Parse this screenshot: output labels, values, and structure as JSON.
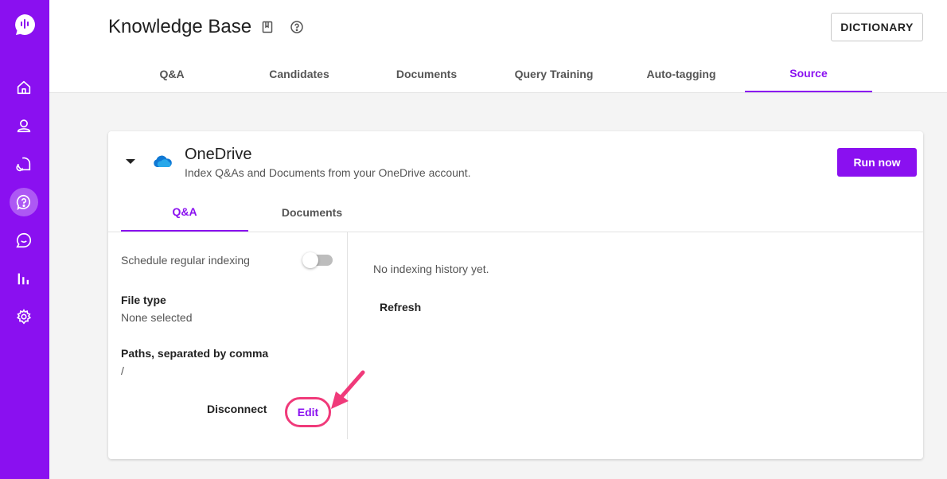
{
  "colors": {
    "brand": "#8a10f0",
    "highlight": "#f03a7a"
  },
  "sidebar": {
    "logo_icon": "chat-logo-icon",
    "items": [
      {
        "icon": "home-icon",
        "active": false
      },
      {
        "icon": "user-icon",
        "active": false
      },
      {
        "icon": "conversations-icon",
        "active": false
      },
      {
        "icon": "knowledge-base-icon",
        "active": true
      },
      {
        "icon": "chat-icon",
        "active": false
      },
      {
        "icon": "analytics-icon",
        "active": false
      },
      {
        "icon": "settings-icon",
        "active": false
      }
    ]
  },
  "header": {
    "title": "Knowledge Base",
    "book_icon": "book-icon",
    "help_icon": "help-icon",
    "dictionary_label": "DICTIONARY",
    "tabs": [
      "Q&A",
      "Candidates",
      "Documents",
      "Query Training",
      "Auto-tagging",
      "Source"
    ],
    "active_tab": "Source"
  },
  "source": {
    "name": "OneDrive",
    "description": "Index Q&As and Documents from your OneDrive account.",
    "run_label": "Run now",
    "tabs": [
      "Q&A",
      "Documents"
    ],
    "active_tab": "Q&A",
    "schedule_label": "Schedule regular indexing",
    "schedule_enabled": false,
    "file_type_label": "File type",
    "file_type_value": "None selected",
    "paths_label": "Paths, separated by comma",
    "paths_value": "/",
    "disconnect_label": "Disconnect",
    "edit_label": "Edit",
    "history_text": "No indexing history yet.",
    "refresh_label": "Refresh"
  }
}
